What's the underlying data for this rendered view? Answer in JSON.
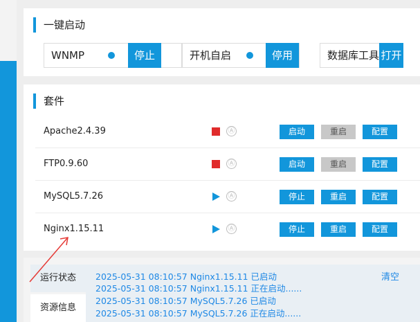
{
  "quick_start": {
    "title": "一键启动",
    "items": [
      {
        "label": "WNMP",
        "button": "停止"
      },
      {
        "label": "开机自启",
        "button": "停用"
      },
      {
        "label": "数据库工具",
        "button": "打开"
      }
    ]
  },
  "suite": {
    "title": "套件",
    "rows": [
      {
        "name": "Apache2.4.39",
        "status": "stopped",
        "auto_icon": "Ⓐ",
        "btn1": "启动",
        "btn2": "重启",
        "btn3": "配置"
      },
      {
        "name": "FTP0.9.60",
        "status": "stopped",
        "auto_icon": "Ⓐ",
        "btn1": "启动",
        "btn2": "重启",
        "btn3": "配置"
      },
      {
        "name": "MySQL5.7.26",
        "status": "running",
        "auto_icon": "Ⓐ",
        "btn1": "停止",
        "btn2": "重启",
        "btn3": "配置"
      },
      {
        "name": "Nginx1.15.11",
        "status": "running",
        "auto_icon": "Ⓐ",
        "btn1": "停止",
        "btn2": "重启",
        "btn3": "配置"
      }
    ]
  },
  "bottom": {
    "tabs": [
      "运行状态",
      "资源信息"
    ],
    "clear": "清空",
    "logs": [
      "2025-05-31 08:10:57 Nginx1.15.11 已启动",
      "2025-05-31 08:10:57 Nginx1.15.11 正在启动......",
      "2025-05-31 08:10:57 MySQL5.7.26 已启动",
      "2025-05-31 08:10:57 MySQL5.7.26 正在启动......"
    ]
  },
  "colors": {
    "accent": "#1296db",
    "stopped": "#e02b2b",
    "disabled": "#c8c8c8",
    "log_text": "#1e88e5",
    "arrow": "#e53935"
  }
}
